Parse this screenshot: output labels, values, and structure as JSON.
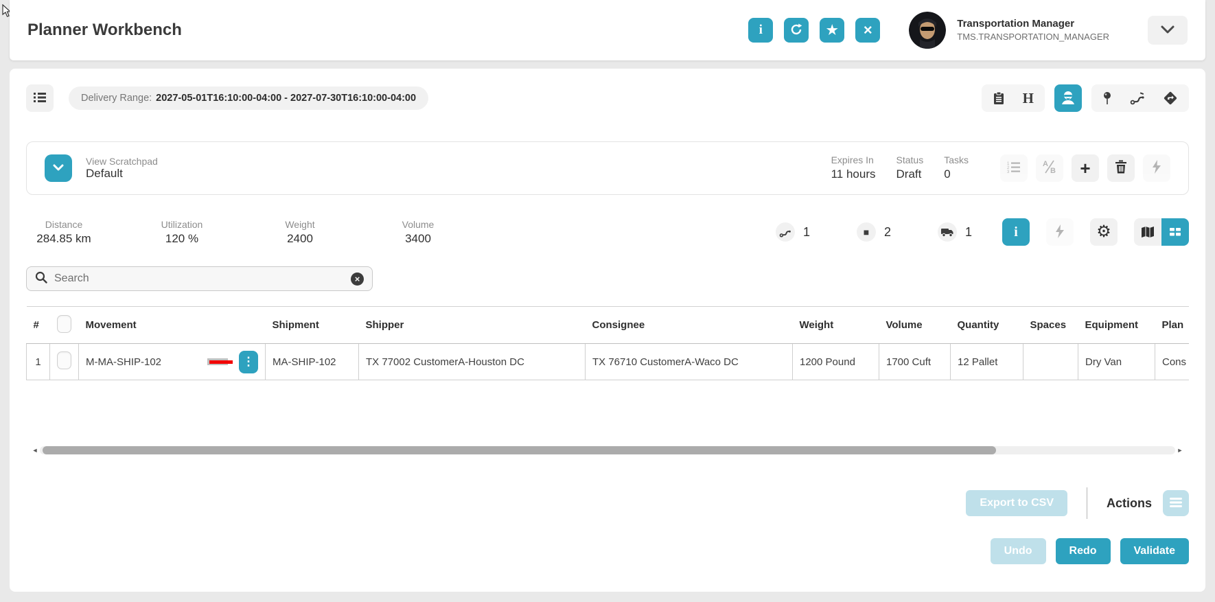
{
  "header": {
    "title": "Planner Workbench",
    "user_name": "Transportation Manager",
    "user_role": "TMS.TRANSPORTATION_MANAGER"
  },
  "toolbar": {
    "delivery_range_label": "Delivery Range:",
    "delivery_range_value": "2027-05-01T16:10:00-04:00 - 2027-07-30T16:10:00-04:00"
  },
  "scratchpad": {
    "view_label": "View Scratchpad",
    "view_value": "Default",
    "expires_label": "Expires In",
    "expires_value": "11 hours",
    "status_label": "Status",
    "status_value": "Draft",
    "tasks_label": "Tasks",
    "tasks_value": "0"
  },
  "stats": [
    {
      "label": "Distance",
      "value": "284.85 km"
    },
    {
      "label": "Utilization",
      "value": "120 %"
    },
    {
      "label": "Weight",
      "value": "2400"
    },
    {
      "label": "Volume",
      "value": "3400"
    }
  ],
  "counters": [
    {
      "icon": "route-icon",
      "value": "1"
    },
    {
      "icon": "stop-icon",
      "value": "2"
    },
    {
      "icon": "truck-icon",
      "value": "1"
    }
  ],
  "search": {
    "placeholder": "Search"
  },
  "table": {
    "headers": [
      "#",
      "Movement",
      "Shipment",
      "Shipper",
      "Consignee",
      "Weight",
      "Volume",
      "Quantity",
      "Spaces",
      "Equipment",
      "Plan"
    ],
    "rows": [
      {
        "index": "1",
        "movement": "M-MA-SHIP-102",
        "shipment": "MA-SHIP-102",
        "shipper": "TX 77002 CustomerA-Houston DC",
        "consignee": "TX 76710 CustomerA-Waco DC",
        "weight": "1200 Pound",
        "volume": "1700 Cuft",
        "quantity": "12 Pallet",
        "spaces": "",
        "equipment": "Dry Van",
        "plan": "Cons"
      }
    ]
  },
  "footer": {
    "export_label": "Export to CSV",
    "actions_label": "Actions",
    "undo_label": "Undo",
    "redo_label": "Redo",
    "validate_label": "Validate"
  },
  "glyphs": {
    "info": "i",
    "star": "★",
    "close": "×",
    "h": "H",
    "ab": "A/B",
    "plus": "+",
    "ellipsis": "⋮",
    "gear": "⚙",
    "square": "■",
    "scroll_left": "◄",
    "scroll_right": "►",
    "clear": "×"
  },
  "colors": {
    "accent": "#2ea2bf",
    "accent_disabled": "#bfe0ea",
    "danger": "#f20000"
  }
}
